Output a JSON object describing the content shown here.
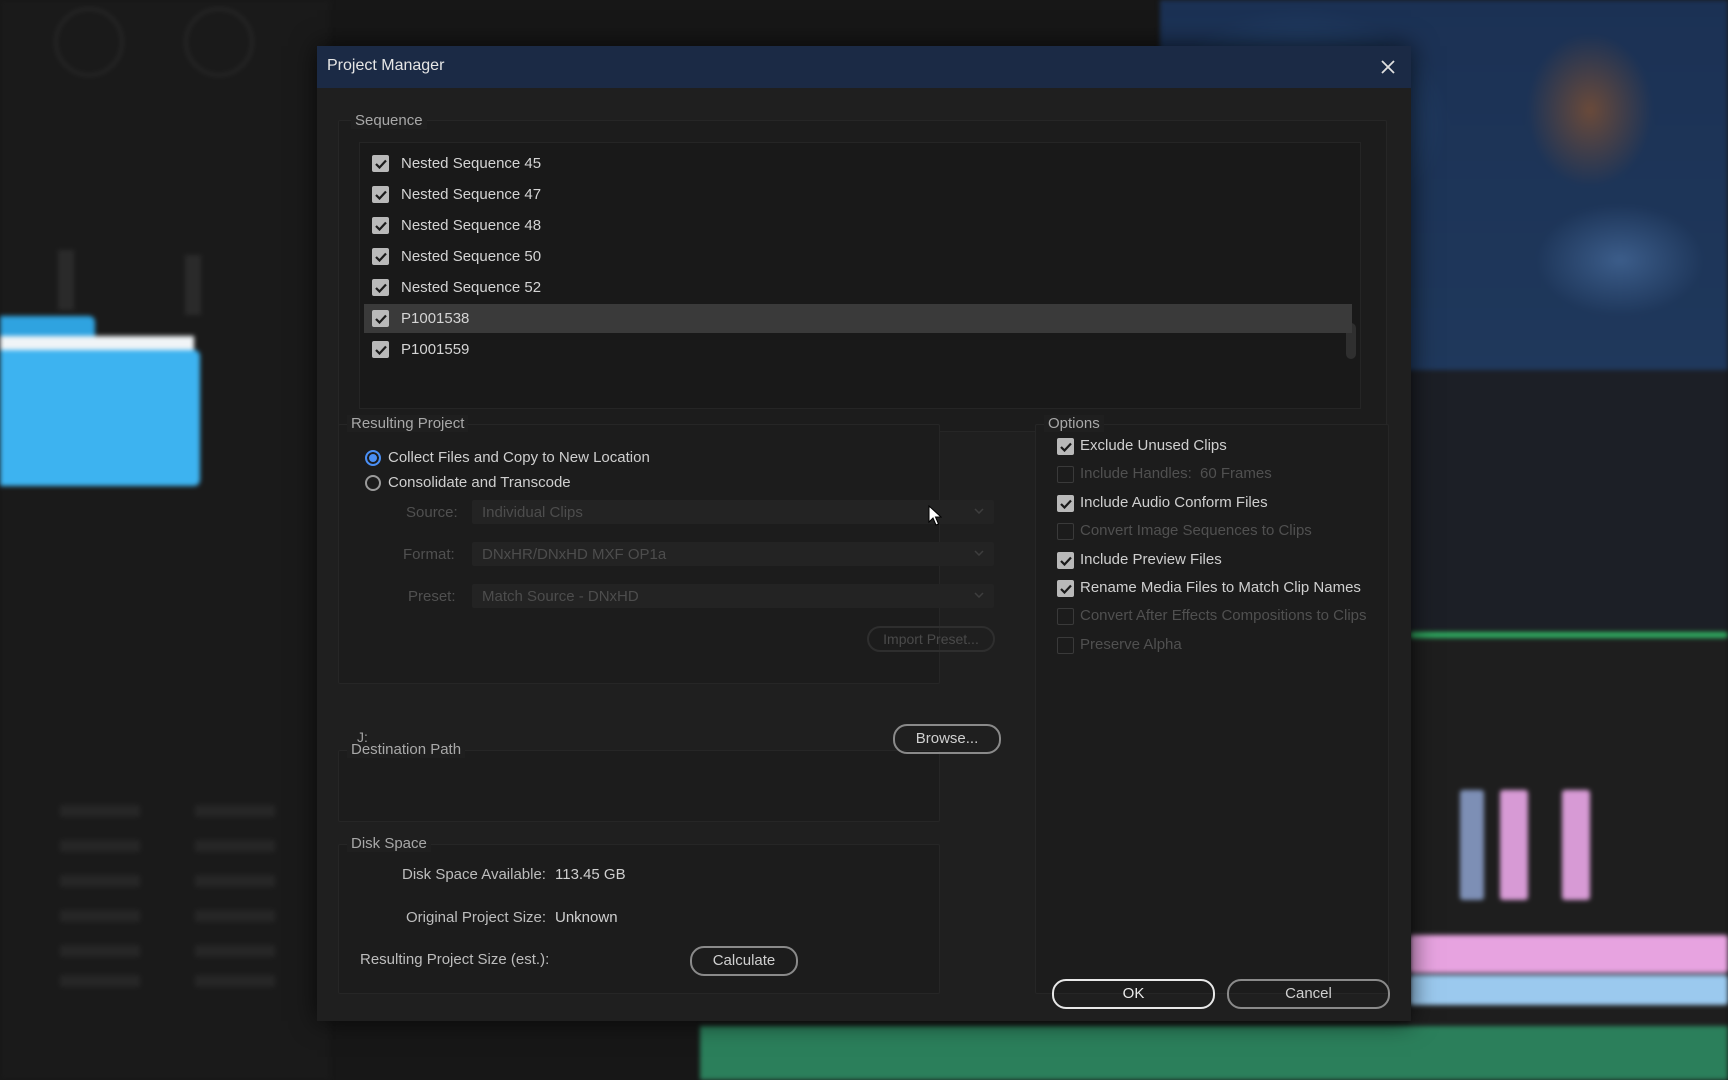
{
  "dialog": {
    "title": "Project Manager"
  },
  "sequence": {
    "label": "Sequence",
    "items": [
      {
        "name": "Nested Sequence 45",
        "checked": true,
        "selected": false
      },
      {
        "name": "Nested Sequence 47",
        "checked": true,
        "selected": false
      },
      {
        "name": "Nested Sequence 48",
        "checked": true,
        "selected": false
      },
      {
        "name": "Nested Sequence 50",
        "checked": true,
        "selected": false
      },
      {
        "name": "Nested Sequence 52",
        "checked": true,
        "selected": false
      },
      {
        "name": "P1001538",
        "checked": true,
        "selected": true
      },
      {
        "name": "P1001559",
        "checked": true,
        "selected": false
      }
    ]
  },
  "resulting_project": {
    "label": "Resulting Project",
    "options": [
      {
        "label": "Collect Files and Copy to New Location",
        "selected": true
      },
      {
        "label": "Consolidate and Transcode",
        "selected": false
      }
    ],
    "source": {
      "label": "Source:",
      "value": "Individual Clips"
    },
    "format": {
      "label": "Format:",
      "value": "DNxHR/DNxHD MXF OP1a"
    },
    "preset": {
      "label": "Preset:",
      "value": "Match Source - DNxHD"
    },
    "import_preset_label": "Import Preset..."
  },
  "options": {
    "label": "Options",
    "items": [
      {
        "label": "Exclude Unused Clips",
        "checked": true,
        "enabled": true
      },
      {
        "label": "Include Handles:",
        "checked": false,
        "enabled": false,
        "extra": "60 Frames"
      },
      {
        "label": "Include Audio Conform Files",
        "checked": true,
        "enabled": true
      },
      {
        "label": "Convert Image Sequences to Clips",
        "checked": false,
        "enabled": false
      },
      {
        "label": "Include Preview Files",
        "checked": true,
        "enabled": true
      },
      {
        "label": "Rename Media Files to Match Clip Names",
        "checked": true,
        "enabled": true
      },
      {
        "label": "Convert After Effects Compositions to Clips",
        "checked": false,
        "enabled": false
      },
      {
        "label": "Preserve Alpha",
        "checked": false,
        "enabled": false
      }
    ]
  },
  "destination": {
    "label": "Destination Path",
    "path": "J:",
    "browse_label": "Browse..."
  },
  "disk_space": {
    "label": "Disk Space",
    "available_label": "Disk Space Available:",
    "available_value": "113.45 GB",
    "original_label": "Original Project Size:",
    "original_value": "Unknown",
    "resulting_label": "Resulting Project Size (est.):",
    "calculate_label": "Calculate"
  },
  "buttons": {
    "ok": "OK",
    "cancel": "Cancel"
  },
  "colors": {
    "titlebar": "#1b2a45",
    "accent": "#4a8ff5",
    "dialog_bg": "#1f1f1f"
  }
}
